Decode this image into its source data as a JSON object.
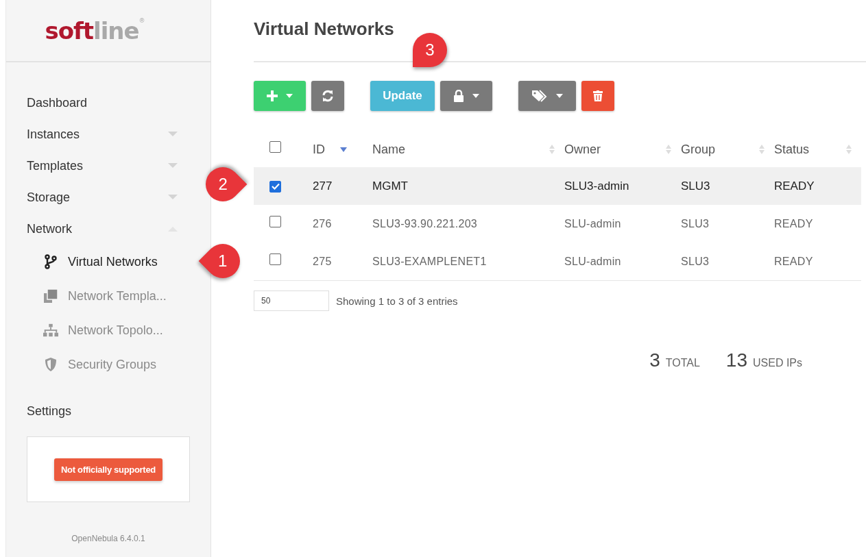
{
  "logo": {
    "first": "soft",
    "second": "line",
    "mark": "®"
  },
  "sidebar": {
    "items": [
      {
        "label": "Dashboard",
        "kind": "link"
      },
      {
        "label": "Instances",
        "kind": "section",
        "expanded": false
      },
      {
        "label": "Templates",
        "kind": "section",
        "expanded": false
      },
      {
        "label": "Storage",
        "kind": "section",
        "expanded": false
      },
      {
        "label": "Network",
        "kind": "section",
        "expanded": true,
        "children": [
          {
            "label": "Virtual Networks",
            "selected": true
          },
          {
            "label": "Network Templa...",
            "selected": false
          },
          {
            "label": "Network Topolo...",
            "selected": false
          },
          {
            "label": "Security Groups",
            "selected": false
          }
        ]
      }
    ],
    "settings": "Settings",
    "notice": "Not officially supported",
    "version": "OpenNebula 6.4.0.1"
  },
  "page_title": "Virtual Networks",
  "toolbar": [
    {
      "kind": "add",
      "caret": true,
      "color": "#3dd071"
    },
    {
      "kind": "refresh",
      "caret": false,
      "color": "#7a7a7a"
    },
    {
      "kind": "text",
      "label": "Update",
      "caret": false,
      "color": "#4bb8d4"
    },
    {
      "kind": "lock",
      "caret": true,
      "color": "#7a7a7a"
    },
    {
      "kind": "tag",
      "caret": true,
      "color": "#7a7a7a"
    },
    {
      "kind": "delete",
      "caret": false,
      "color": "#ec4e34"
    }
  ],
  "table": {
    "select_all": {
      "checked": false
    },
    "columns": [
      {
        "label": "ID",
        "sorted": true
      },
      {
        "label": "Name",
        "sorted": false
      },
      {
        "label": "Owner",
        "sorted": false
      },
      {
        "label": "Group",
        "sorted": false
      },
      {
        "label": "Status",
        "sorted": false
      }
    ],
    "rows": [
      {
        "checked": true,
        "selected": true,
        "cells": [
          "277",
          "MGMT",
          "SLU3-admin",
          "SLU3",
          "READY"
        ]
      },
      {
        "checked": false,
        "selected": false,
        "cells": [
          "276",
          "SLU3-93.90.221.203",
          "SLU-admin",
          "SLU3",
          "READY"
        ]
      },
      {
        "checked": false,
        "selected": false,
        "cells": [
          "275",
          "SLU3-EXAMPLENET1",
          "SLU-admin",
          "SLU3",
          "READY"
        ]
      }
    ]
  },
  "page_size": {
    "value": "50"
  },
  "entries_info": "Showing 1 to 3 of 3 entries",
  "stats": [
    {
      "value": "3",
      "label": "TOTAL"
    },
    {
      "value": "13",
      "label": "USED IPs"
    }
  ],
  "callouts": [
    {
      "label": "1"
    },
    {
      "label": "2"
    },
    {
      "label": "3"
    }
  ]
}
